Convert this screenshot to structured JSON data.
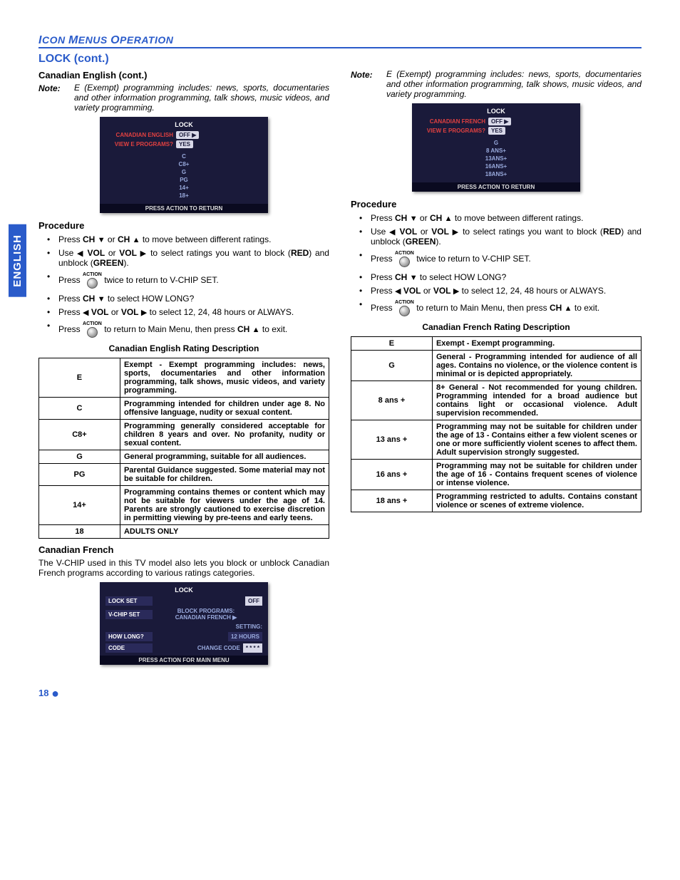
{
  "header": {
    "section": "ICON MENUS OPERATION",
    "title": "LOCK (cont.)"
  },
  "sideTab": "ENGLISH",
  "left": {
    "sub1": "Canadian English (cont.)",
    "noteLabel": "Note:",
    "note": "E (Exempt) programming includes: news, sports, documentaries and other information programming, talk shows, music videos, and variety programming.",
    "osd1": {
      "title": "LOCK",
      "row1l": "CANADIAN ENGLISH",
      "row1v": "OFF ▶",
      "row2l": "VIEW E PROGRAMS?",
      "row2v": "YES",
      "list": [
        "C",
        "C8+",
        "G",
        "PG",
        "14+",
        "18+"
      ],
      "foot": "PRESS ACTION TO RETURN"
    },
    "procHead": "Procedure",
    "p1a": "Press ",
    "p1b_ch": "CH",
    "p1c": " or ",
    "p1d": "  to move between different ratings.",
    "p2a": "Use ",
    "p2vol": "VOL",
    "p2or": " or ",
    "p2b": " to select ratings you want to block (",
    "p2red": "RED",
    "p2c": ") and unblock (",
    "p2green": "GREEN",
    "p2d": ").",
    "p3a": "Press ",
    "p3b": " twice to return to V-CHIP SET.",
    "p4a": "Press ",
    "p4b": " to select HOW LONG?",
    "p5a": "Press ",
    "p5b": " to select 12, 24, 48 hours or ALWAYS.",
    "p6a": "Press ",
    "p6b": " to return to Main Menu, then press ",
    "p6c": " to exit.",
    "actionLabel": "ACTION",
    "tableCaption": "Canadian English Rating Description",
    "table": [
      [
        "E",
        "Exempt - Exempt programming includes: news, sports, documentaries and other information programming, talk shows, music videos, and variety programming."
      ],
      [
        "C",
        "Programming intended for children under age 8. No offensive language, nudity or sexual content."
      ],
      [
        "C8+",
        "Programming generally considered acceptable for children 8 years and over. No profanity, nudity or sexual content."
      ],
      [
        "G",
        "General programming, suitable for all audiences."
      ],
      [
        "PG",
        "Parental Guidance suggested. Some material may not be suitable for children."
      ],
      [
        "14+",
        "Programming contains themes or content which may not be suitable for viewers under the age of 14. Parents are strongly cautioned to exercise discretion in permitting viewing by pre-teens and early teens."
      ],
      [
        "18",
        "ADULTS ONLY"
      ]
    ],
    "sub2": "Canadian French",
    "intro": "The V-CHIP used in this TV model also lets you block or unblock Canadian French programs according to various ratings categories.",
    "osd2": {
      "title": "LOCK",
      "r1l": "LOCK SET",
      "r1v": "OFF",
      "r2l": "V-CHIP SET",
      "r2m1": "BLOCK PROGRAMS:",
      "r2m2": "CANADIAN FRENCH ▶",
      "sec": "SETTING:",
      "r3l": "HOW LONG?",
      "r3v": "12 HOURS",
      "r4l": "CODE",
      "r4m": "CHANGE CODE",
      "r4v": "* * * *",
      "foot": "PRESS ACTION FOR MAIN MENU"
    }
  },
  "right": {
    "noteLabel": "Note:",
    "note": "E (Exempt) programming includes: news, sports, documentaries and other information programming, talk shows, music videos, and variety programming.",
    "osd1": {
      "title": "LOCK",
      "row1l": "CANADIAN FRENCH",
      "row1v": "OFF ▶",
      "row2l": "VIEW E PROGRAMS?",
      "row2v": "YES",
      "list": [
        "G",
        "8  ANS+",
        "13ANS+",
        "16ANS+",
        "18ANS+"
      ],
      "foot": "PRESS ACTION TO RETURN"
    },
    "procHead": "Procedure",
    "tableCaption": "Canadian French Rating Description",
    "table": [
      [
        "E",
        "Exempt - Exempt programming."
      ],
      [
        "G",
        "General - Programming intended for audience of all ages. Contains no violence, or the violence content is minimal or is depicted appropriately."
      ],
      [
        "8 ans +",
        "8+ General - Not recommended for young children. Programming intended for a broad audience but contains light or occasional violence. Adult supervision recommended."
      ],
      [
        "13 ans +",
        "Programming may not be suitable for children under the age of 13 - Contains either a few violent scenes or one or more sufficiently violent scenes to affect them. Adult supervision strongly suggested."
      ],
      [
        "16 ans +",
        "Programming may not be suitable for children under the age of 16 - Contains frequent scenes of violence or intense violence."
      ],
      [
        "18 ans +",
        "Programming restricted to adults. Contains constant violence or scenes of extreme violence."
      ]
    ]
  },
  "pageNum": "18"
}
